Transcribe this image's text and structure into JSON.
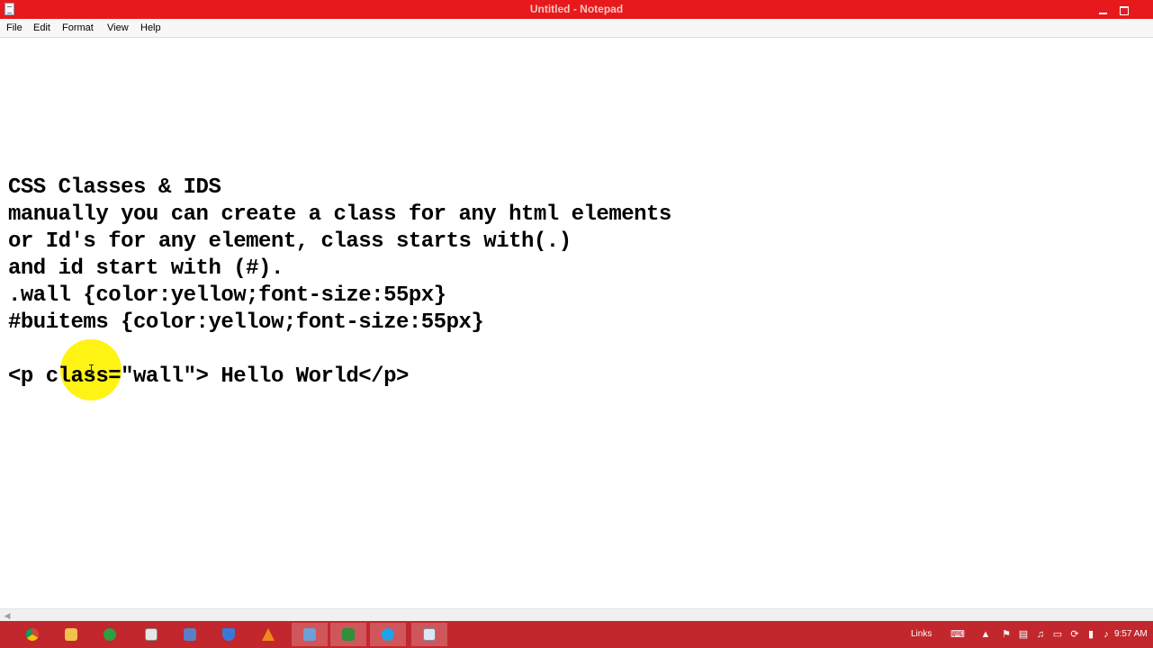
{
  "window": {
    "title": "Untitled - Notepad",
    "icons": {
      "app": "notepad-icon",
      "minimize": "minimize-icon",
      "maximize": "maximize-icon"
    }
  },
  "menu": [
    "File",
    "Edit",
    "Format",
    "View",
    "Help"
  ],
  "document": {
    "lines": [
      "CSS Classes & IDS",
      "manually you can create a class for any html elements",
      "or Id's for any element, class starts with(.)",
      "and id start with (#).",
      ".wall {color:yellow;font-size:55px}",
      "#buitems {color:yellow;font-size:55px}",
      "",
      "<p class=\"wall\"> Hello World</p>"
    ]
  },
  "cursor_highlight": {
    "color": "#fff200"
  },
  "taskbar": {
    "apps": [
      {
        "name": "chrome-icon",
        "color": "#e8a020",
        "active": false
      },
      {
        "name": "folder-icon",
        "color": "#f2c14e",
        "active": false
      },
      {
        "name": "green-app-icon",
        "color": "#2e9e3e",
        "active": false
      },
      {
        "name": "document-app-icon",
        "color": "#e6e6e6",
        "active": false
      },
      {
        "name": "virtualbox-icon",
        "color": "#5b7fc7",
        "active": false
      },
      {
        "name": "shield-app-icon",
        "color": "#3a78d8",
        "active": false
      },
      {
        "name": "vlc-icon",
        "color": "#f08a1c",
        "active": false
      },
      {
        "name": "monitor-app-icon",
        "color": "#6ea0d8",
        "active": true
      },
      {
        "name": "excel-icon",
        "color": "#2f8f3a",
        "active": true
      },
      {
        "name": "skype-icon",
        "color": "#1fa3e8",
        "active": true
      },
      {
        "name": "notepad-icon",
        "color": "#dfe8f2",
        "active": true
      }
    ],
    "tray": {
      "links_label": "Links",
      "clock": "9:57 AM"
    }
  },
  "colors": {
    "titlebar": "#e8191c",
    "taskbar": "#c2272d",
    "menubar": "#f7f7f7",
    "editor_bg": "#ffffff"
  }
}
